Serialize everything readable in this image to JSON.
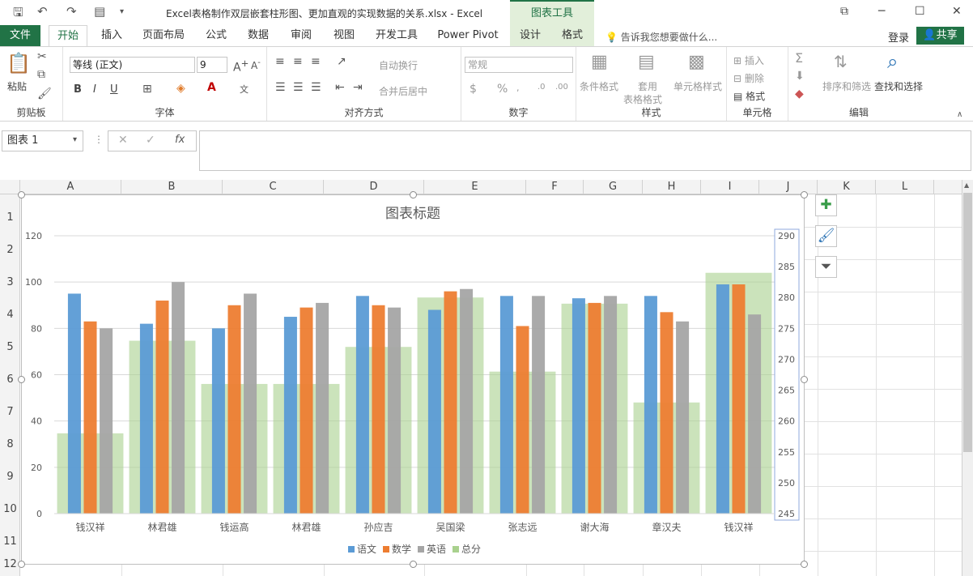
{
  "app": {
    "window_title": "Excel表格制作双层嵌套柱形图、更加直观的实现数据的关系.xlsx - Excel",
    "context_tools": "图表工具"
  },
  "tabs": {
    "file": "文件",
    "home": "开始",
    "insert": "插入",
    "page_layout": "页面布局",
    "formulas": "公式",
    "data": "数据",
    "review": "审阅",
    "view": "视图",
    "developer": "开发工具",
    "power_pivot": "Power Pivot",
    "design": "设计",
    "format": "格式",
    "tell_me": "告诉我您想要做什么...",
    "login": "登录",
    "share": "共享"
  },
  "ribbon": {
    "clipboard": {
      "label": "剪贴板",
      "paste": "粘贴"
    },
    "font": {
      "label": "字体",
      "name": "等线 (正文)",
      "size": "9",
      "bold": "B",
      "italic": "I",
      "underline": "U"
    },
    "align": {
      "label": "对齐方式",
      "wrap": "自动换行",
      "merge": "合并后居中"
    },
    "number": {
      "label": "数字",
      "format": "常规"
    },
    "styles": {
      "label": "样式",
      "cond": "条件格式",
      "table1": "套用",
      "table2": "表格格式",
      "cell": "单元格样式"
    },
    "cells": {
      "label": "单元格",
      "insert": "插入",
      "delete": "删除",
      "format": "格式"
    },
    "edit": {
      "label": "编辑",
      "sort": "排序和筛选",
      "find": "查找和选择"
    }
  },
  "formula_bar": {
    "name_box": "图表 1",
    "value": ""
  },
  "columns": [
    "A",
    "B",
    "C",
    "D",
    "E",
    "F",
    "G",
    "H",
    "I",
    "J",
    "K",
    "L"
  ],
  "rows": [
    "1",
    "2",
    "3",
    "4",
    "5",
    "6",
    "7",
    "8",
    "9",
    "10",
    "11",
    "12"
  ],
  "chart_data": {
    "type": "bar",
    "title": "图表标题",
    "categories": [
      "钱汉祥",
      "林君雄",
      "钱运高",
      "林君雄",
      "孙应吉",
      "吴国梁",
      "张志远",
      "谢大海",
      "章汉夫",
      "钱汉祥"
    ],
    "series": [
      {
        "name": "语文",
        "axis": "primary",
        "color": "#5b9bd5",
        "values": [
          95,
          82,
          80,
          85,
          94,
          88,
          94,
          93,
          94,
          99
        ]
      },
      {
        "name": "数学",
        "axis": "primary",
        "color": "#ed7d31",
        "values": [
          83,
          92,
          90,
          89,
          90,
          96,
          81,
          91,
          87,
          99
        ]
      },
      {
        "name": "英语",
        "axis": "primary",
        "color": "#a5a5a5",
        "values": [
          80,
          100,
          95,
          91,
          89,
          97,
          94,
          94,
          83,
          86
        ]
      },
      {
        "name": "总分",
        "axis": "secondary",
        "color": "#a9d18e",
        "values": [
          258,
          273,
          266,
          266,
          272,
          280,
          268,
          279,
          263,
          284
        ]
      }
    ],
    "ylim": [
      0,
      120
    ],
    "yticks": [
      0,
      20,
      40,
      60,
      80,
      100,
      120
    ],
    "y2lim": [
      245,
      290
    ],
    "y2ticks": [
      245,
      250,
      255,
      260,
      265,
      270,
      275,
      280,
      285,
      290
    ],
    "legend": "bottom",
    "grid": true
  }
}
